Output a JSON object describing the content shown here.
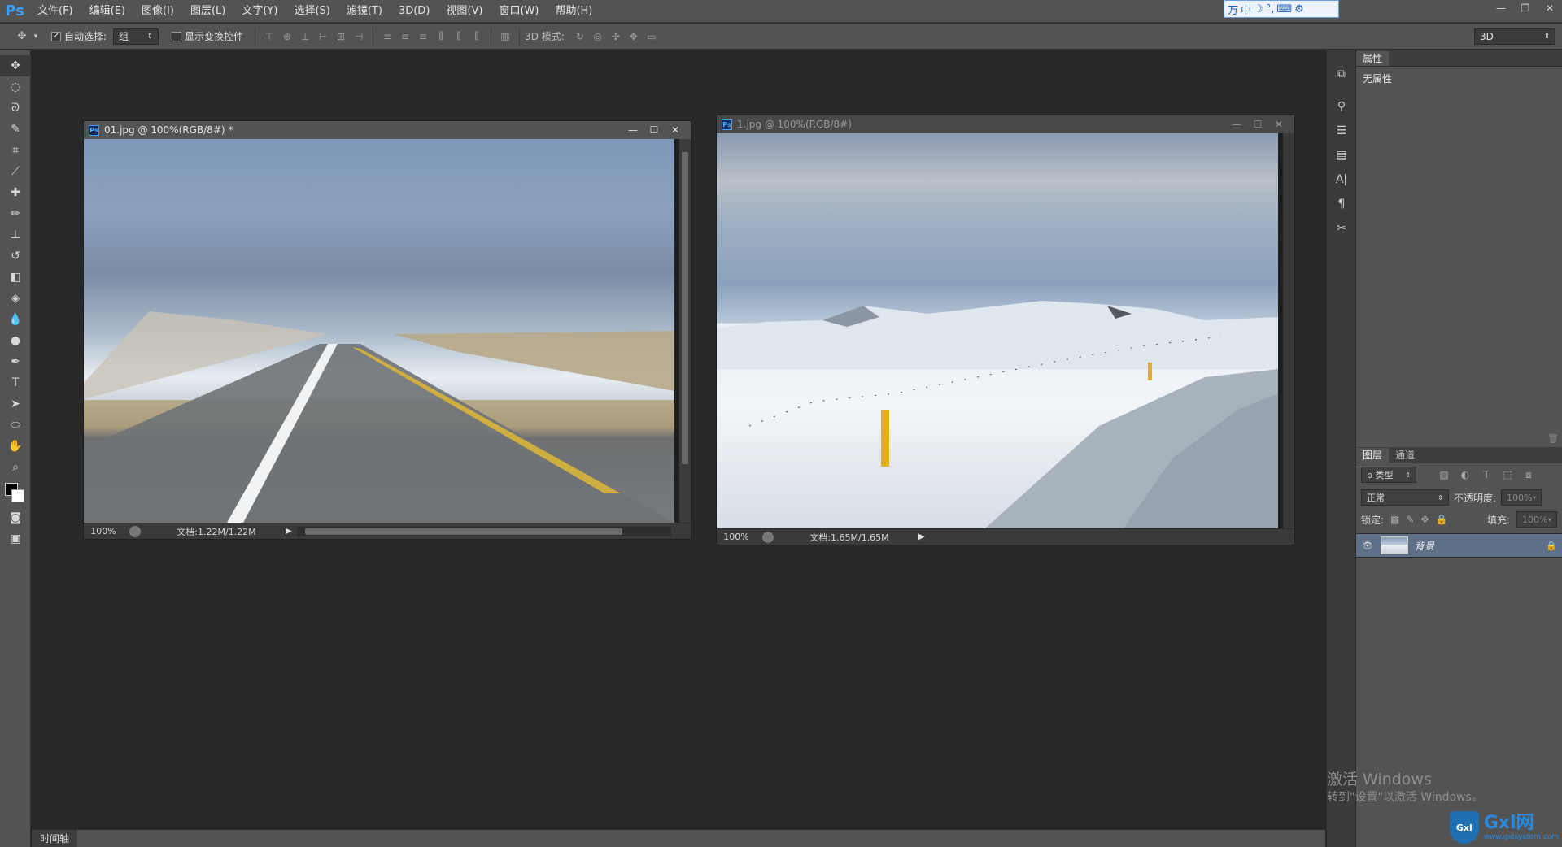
{
  "app": {
    "logo": "Ps",
    "menu": [
      "文件(F)",
      "编辑(E)",
      "图像(I)",
      "图层(L)",
      "文字(Y)",
      "选择(S)",
      "滤镜(T)",
      "3D(D)",
      "视图(V)",
      "窗口(W)",
      "帮助(H)"
    ],
    "ime": [
      "万",
      "中",
      "☽",
      "°,",
      "⌨",
      "⚙"
    ],
    "window_controls": [
      "—",
      "❐",
      "✕"
    ]
  },
  "options": {
    "auto_select_label": "自动选择:",
    "auto_select_checked": "✓",
    "auto_select_value": "组",
    "show_transform_label": "显示变换控件",
    "mode_3d_label": "3D 模式:",
    "workspace_value": "3D"
  },
  "documents": [
    {
      "title": "01.jpg @ 100%(RGB/8#) *",
      "zoom": "100%",
      "doc_info": "文档:1.22M/1.22M",
      "buttons": [
        "—",
        "☐",
        "✕"
      ]
    },
    {
      "title": "1.jpg @ 100%(RGB/8#)",
      "zoom": "100%",
      "doc_info": "文档:1.65M/1.65M",
      "buttons": [
        "—",
        "☐",
        "✕"
      ]
    }
  ],
  "properties_panel": {
    "tab": "属性",
    "body": "无属性"
  },
  "layers_panel": {
    "tabs": [
      "图层",
      "通道"
    ],
    "filter_value": "ρ 类型",
    "blend_mode": "正常",
    "opacity_label": "不透明度:",
    "opacity_value": "100%",
    "lock_label": "锁定:",
    "fill_label": "填充:",
    "fill_value": "100%",
    "layer_name": "背景"
  },
  "bottom": {
    "timeline_tab": "时间轴"
  },
  "watermark": {
    "activate_title": "激活 Windows",
    "activate_sub": "转到\"设置\"以激活 Windows。",
    "site_name": "Gxl网",
    "site_url": "www.gxlsystem.com",
    "site_badge": "Gxl"
  },
  "colors": {
    "accent": "#3aa0ff",
    "panel_bg": "#535353",
    "workspace_bg": "#282828",
    "selected_layer": "#5e6f88"
  }
}
